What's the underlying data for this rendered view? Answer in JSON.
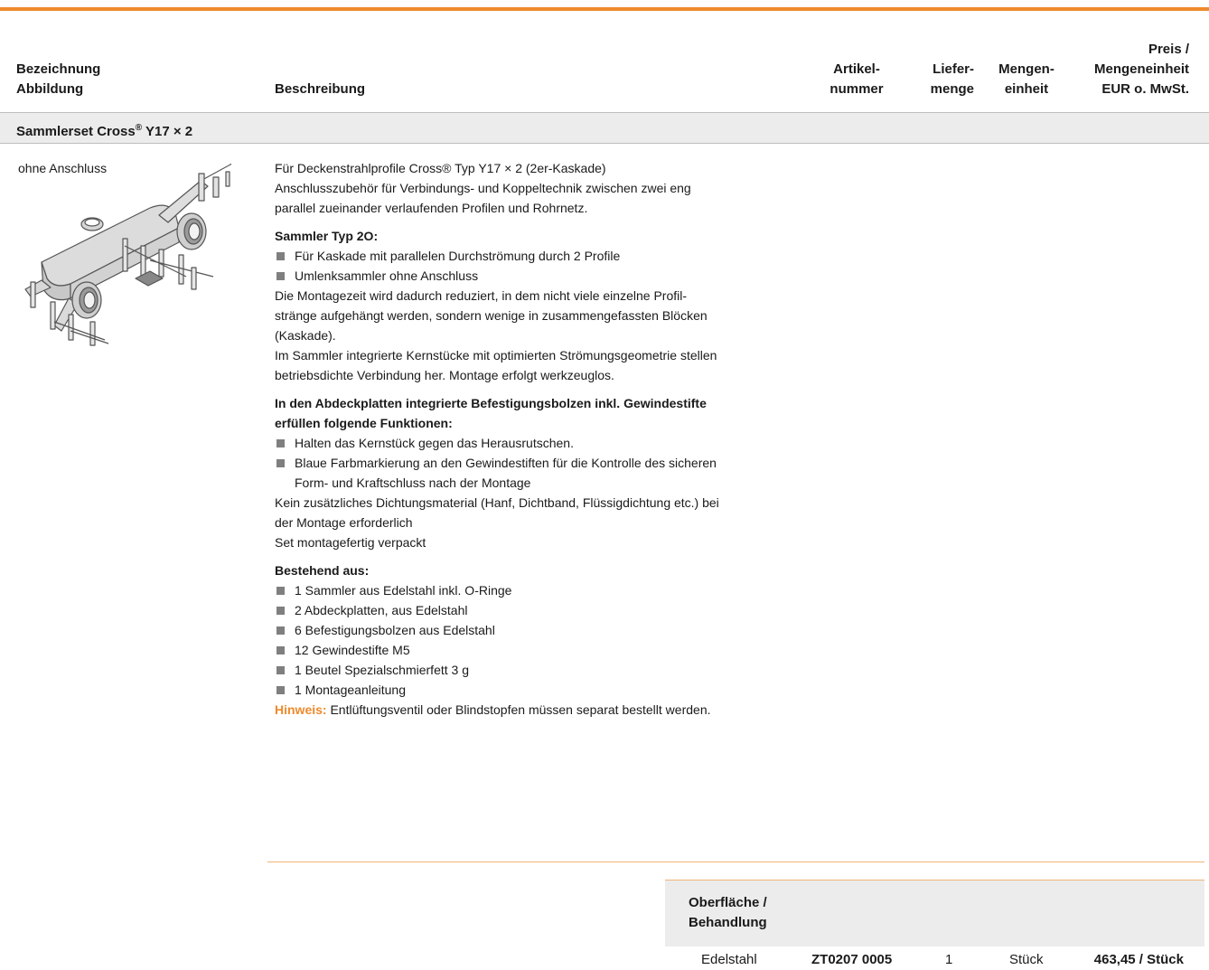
{
  "header": {
    "col1_line1": "Bezeichnung",
    "col1_line2": "Abbildung",
    "col2": "Beschreibung",
    "col3_line1": "Artikel-",
    "col3_line2": "nummer",
    "col4_line1": "Liefer-",
    "col4_line2": "menge",
    "col5_line1": "Mengen-",
    "col5_line2": "einheit",
    "col6_line1": "Preis / ",
    "col6_line2": "Mengeneinheit",
    "col6_line3": "EUR o. MwSt."
  },
  "section": {
    "title_prefix": "Sammlerset Cross",
    "title_reg": "®",
    "title_suffix": " Y17 × 2"
  },
  "product": {
    "label": "ohne Anschluss",
    "image_name": "sammlerset-image"
  },
  "description": {
    "intro": [
      "Für Deckenstrahlprofile Cross® Typ Y17 × 2 (2er-Kaskade)",
      "Anschlusszubehör für Verbindungs- und Koppeltechnik zwischen zwei eng",
      "parallel zueinander verlaufenden Profilen und Rohrnetz."
    ],
    "heading1": "Sammler Typ 2O:",
    "bullets1": [
      "Für Kaskade mit parallelen Durchströmung durch 2 Profile",
      "Umlenksammler ohne Anschluss"
    ],
    "para1": [
      "Die Montagezeit wird dadurch reduziert, in dem nicht viele einzelne Profil-",
      "stränge aufgehängt werden, sondern wenige in zusammengefassten Blöcken",
      "(Kaskade).",
      "Im Sammler integrierte Kernstücke mit optimierten Strömungsgeometrie stellen",
      "betriebsdichte Verbindung her. Montage erfolgt werkzeuglos."
    ],
    "heading2_line1": "In den Abdeckplatten integrierte Befestigungsbolzen inkl. Gewindestifte",
    "heading2_line2": "erfüllen folgende Funktionen:",
    "bullets2": [
      "Halten das Kernstück gegen das Herausrutschen.",
      "Blaue Farbmarkierung an den Gewindestiften für die Kontrolle des sicheren"
    ],
    "bullets2_cont": "Form- und Kraftschluss nach der Montage",
    "para2": [
      "Kein zusätzliches Dichtungsmaterial (Hanf, Dichtband, Flüssigdichtung etc.) bei",
      "der Montage erforderlich",
      "Set montagefertig verpackt"
    ],
    "heading3": "Bestehend aus:",
    "bullets3": [
      "1 Sammler aus Edelstahl inkl. O-Ringe",
      "2 Abdeckplatten, aus Edelstahl",
      "6 Befestigungsbolzen aus Edelstahl",
      "12 Gewindestifte M5",
      "1 Beutel Spezialschmierfett 3 g",
      "1 Montageanleitung"
    ],
    "note_label": "Hinweis:",
    "note_text": " Entlüftungsventil oder Blindstopfen müssen separat bestellt werden."
  },
  "subtable": {
    "header_line1": "Oberfläche / ",
    "header_line2": "Behandlung",
    "row": {
      "surface": "Edelstahl",
      "article": "ZT0207 0005",
      "quantity": "1",
      "unit": "Stück",
      "price": "463,45 / Stück"
    }
  },
  "colors": {
    "accent": "#ee8a2c",
    "band": "#ececec"
  }
}
